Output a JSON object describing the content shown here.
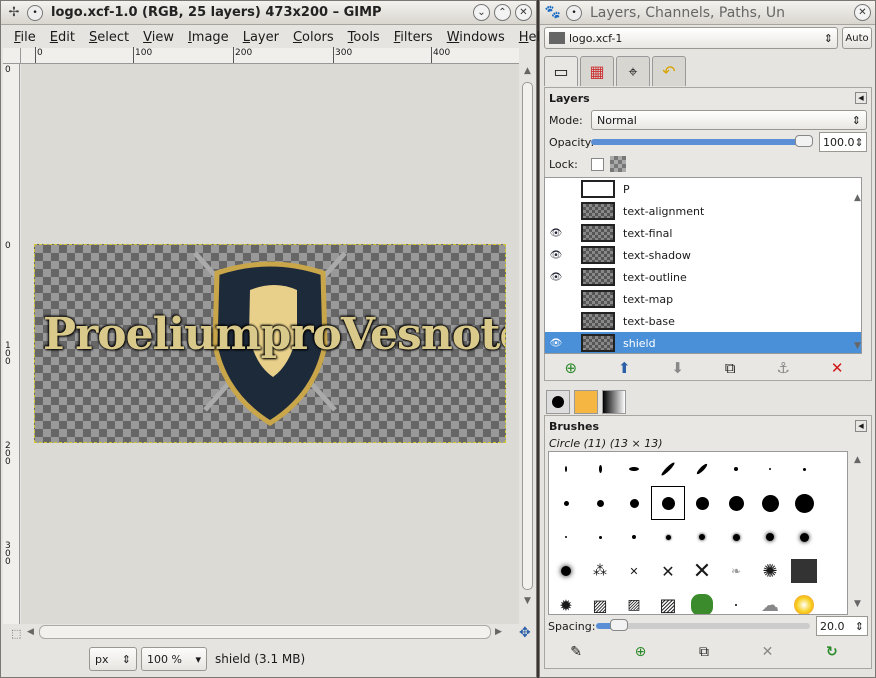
{
  "image_window": {
    "title": "logo.xcf-1.0 (RGB, 25 layers) 473x200 – GIMP",
    "menu": [
      "File",
      "Edit",
      "Select",
      "View",
      "Image",
      "Layer",
      "Colors",
      "Tools",
      "Filters",
      "Windows",
      "Help"
    ],
    "ruler_h_labels": [
      "0",
      "100",
      "200",
      "300",
      "400"
    ],
    "ruler_v_labels": [
      "0",
      "0",
      "1 0 0",
      "2 0 0",
      "3 0 0"
    ],
    "canvas_text": "ProeliumproVesnote",
    "status": {
      "unit": "px",
      "zoom": "100 %",
      "info": "shield (3.1 MB)"
    }
  },
  "dock": {
    "title": "Layers, Channels, Paths, Un",
    "image_select": "logo.xcf-1",
    "auto_label": "Auto",
    "layers_panel": {
      "heading": "Layers",
      "mode_label": "Mode:",
      "mode_value": "Normal",
      "opacity_label": "Opacity:",
      "opacity_value": "100.0",
      "opacity_fraction": 1.0,
      "lock_label": "Lock:",
      "layers": [
        {
          "name": "P",
          "visible": false,
          "selected": false
        },
        {
          "name": "text-alignment",
          "visible": false,
          "selected": false
        },
        {
          "name": "text-final",
          "visible": true,
          "selected": false
        },
        {
          "name": "text-shadow",
          "visible": true,
          "selected": false
        },
        {
          "name": "text-outline",
          "visible": true,
          "selected": false
        },
        {
          "name": "text-map",
          "visible": false,
          "selected": false
        },
        {
          "name": "text-base",
          "visible": false,
          "selected": false
        },
        {
          "name": "shield",
          "visible": true,
          "selected": true
        }
      ]
    },
    "brushes_panel": {
      "heading": "Brushes",
      "current": "Circle (11) (13 × 13)",
      "spacing_label": "Spacing:",
      "spacing_value": "20.0"
    }
  },
  "colors": {
    "selection": "#4a90d9",
    "delete_red": "#d01818",
    "anchor_gray": "#888888"
  }
}
